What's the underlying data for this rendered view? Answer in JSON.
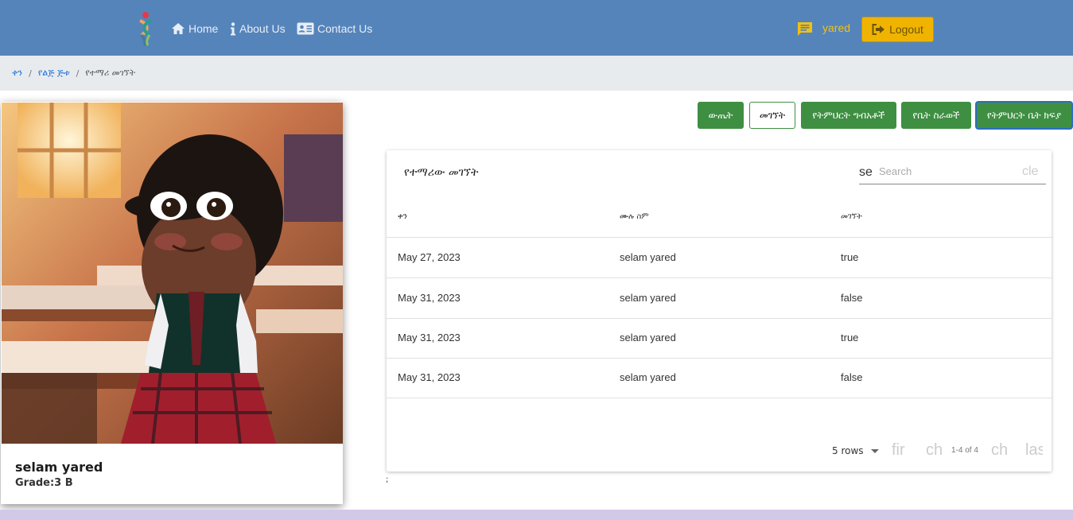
{
  "nav": {
    "home": "Home",
    "about": "About Us",
    "contact": "Contact Us",
    "username": "yared",
    "logout": "Logout",
    "icons": [
      "logo-icon",
      "home-icon",
      "info-icon",
      "contact-card-icon",
      "message-icon",
      "logout-icon"
    ]
  },
  "breadcrumb": {
    "items": [
      "ቀን",
      "የልጅ ጅቱ",
      "የተማሪ መገኘት"
    ]
  },
  "student": {
    "name": "selam yared",
    "grade": "Grade:3 B"
  },
  "actions": {
    "result": "ውጤት",
    "attendance": "መገኘት",
    "materials": "የትምህርት ግብአቶች",
    "homework": "የቤት ስራወች",
    "fee": "የትምህርት ቤት ክፍያ"
  },
  "table": {
    "title": "የተማሪው መገኘት",
    "search_icon_text": "se",
    "search_placeholder": "Search",
    "clear_text": "cle",
    "headers": [
      "ቀን",
      "ሙሉ ስም",
      "መገኘት"
    ],
    "rows": [
      [
        "May 27, 2023",
        "selam yared",
        "true"
      ],
      [
        "May 31, 2023",
        "selam yared",
        "false"
      ],
      [
        "May 31, 2023",
        "selam yared",
        "true"
      ],
      [
        "May 31, 2023",
        "selam yared",
        "false"
      ]
    ],
    "rows_per_page": "5 rows",
    "page_info": "1-4 of 4",
    "pager_first": "fir",
    "pager_prev": "ch",
    "pager_next": "ch",
    "pager_last": "las"
  },
  "misc": {
    "stray_text": ";"
  },
  "colors": {
    "navbar": "#5584bb",
    "accent_green": "#3f8f43",
    "logout": "#f0b400",
    "link": "#1e6fd9",
    "footer": "#d2c8e8"
  }
}
